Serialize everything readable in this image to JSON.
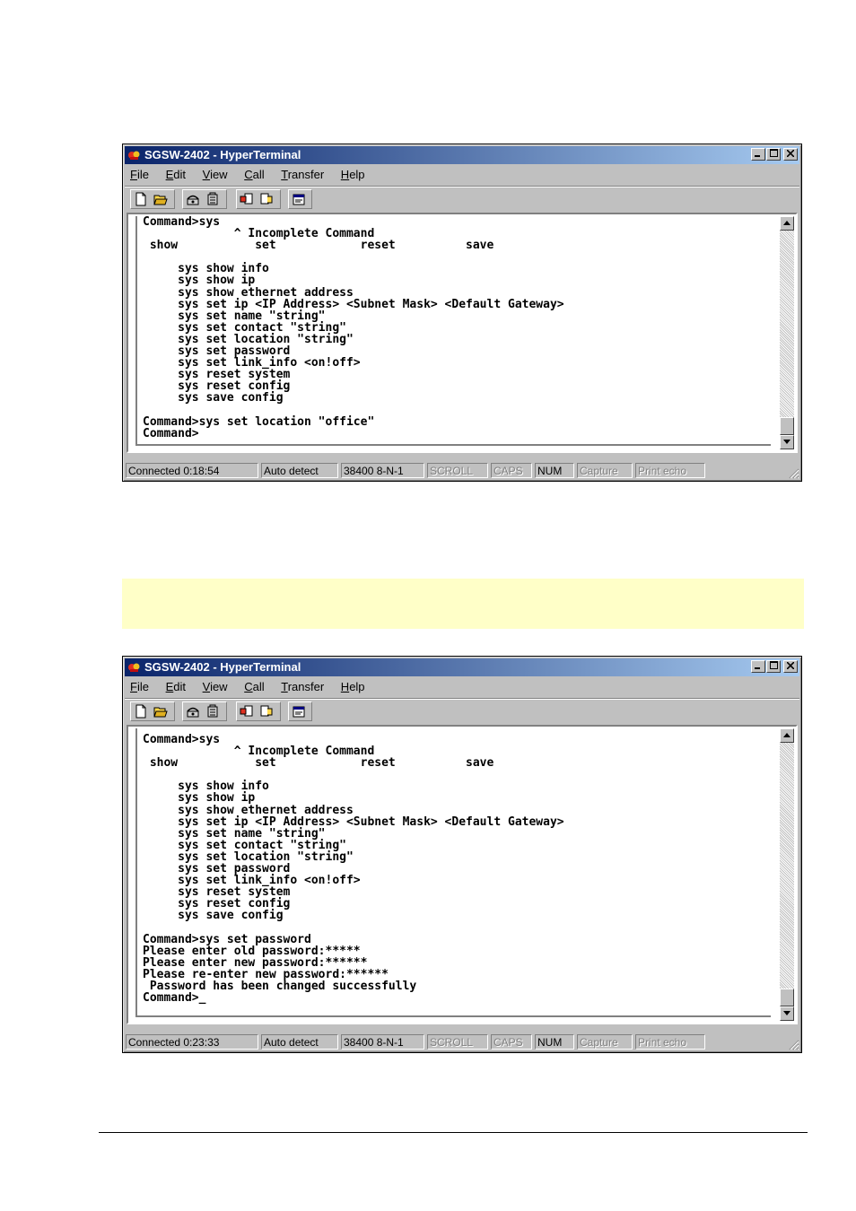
{
  "window1": {
    "title": "SGSW-2402 - HyperTerminal",
    "menu": [
      {
        "u": "F",
        "rest": "ile"
      },
      {
        "u": "E",
        "rest": "dit"
      },
      {
        "u": "V",
        "rest": "iew"
      },
      {
        "u": "C",
        "rest": "all"
      },
      {
        "u": "T",
        "rest": "ransfer"
      },
      {
        "u": "H",
        "rest": "elp"
      }
    ],
    "terminal": "Command>sys\n             ^ Incomplete Command\n show           set            reset          save\n\n     sys show info\n     sys show ip\n     sys show ethernet address\n     sys set ip <IP Address> <Subnet Mask> <Default Gateway>\n     sys set name \"string\"\n     sys set contact \"string\"\n     sys set location \"string\"\n     sys set password\n     sys set link_info <on!off>\n     sys reset system\n     sys reset config\n     sys save config\n\nCommand>sys set location \"office\"\nCommand>",
    "status": {
      "connected": "Connected 0:18:54",
      "detect": "Auto detect",
      "baud": "38400 8-N-1",
      "scroll": "SCROLL",
      "caps": "CAPS",
      "num": "NUM",
      "capture": "Capture",
      "print_echo": "Print echo"
    }
  },
  "window2": {
    "title": "SGSW-2402 - HyperTerminal",
    "menu": [
      {
        "u": "F",
        "rest": "ile"
      },
      {
        "u": "E",
        "rest": "dit"
      },
      {
        "u": "V",
        "rest": "iew"
      },
      {
        "u": "C",
        "rest": "all"
      },
      {
        "u": "T",
        "rest": "ransfer"
      },
      {
        "u": "H",
        "rest": "elp"
      }
    ],
    "terminal": "Command>sys\n             ^ Incomplete Command\n show           set            reset          save\n\n     sys show info\n     sys show ip\n     sys show ethernet address\n     sys set ip <IP Address> <Subnet Mask> <Default Gateway>\n     sys set name \"string\"\n     sys set contact \"string\"\n     sys set location \"string\"\n     sys set password\n     sys set link_info <on!off>\n     sys reset system\n     sys reset config\n     sys save config\n\nCommand>sys set password\nPlease enter old password:*****\nPlease enter new password:******\nPlease re-enter new password:******\n Password has been changed successfully\nCommand>_",
    "status": {
      "connected": "Connected 0:23:33",
      "detect": "Auto detect",
      "baud": "38400 8-N-1",
      "scroll": "SCROLL",
      "caps": "CAPS",
      "num": "NUM",
      "capture": "Capture",
      "print_echo": "Print echo"
    }
  },
  "colors": {
    "titlebar_start": "#0a246a",
    "titlebar_end": "#a6caf0",
    "window_face": "#c0c0c0",
    "note_band": "#ffffc8"
  },
  "icons": [
    "hyperterminal-icon",
    "new-icon",
    "open-icon",
    "connect-icon",
    "disconnect-icon",
    "send-icon",
    "receive-icon",
    "properties-icon"
  ]
}
